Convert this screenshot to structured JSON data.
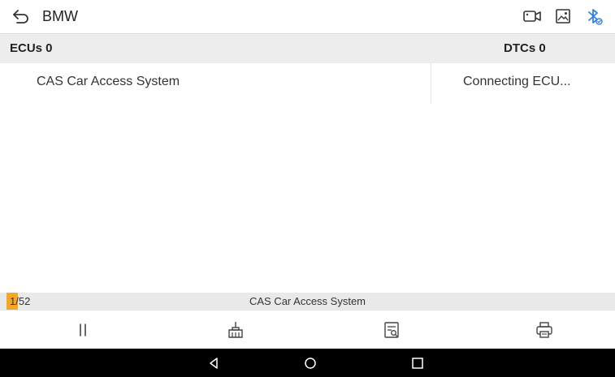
{
  "header": {
    "title": "BMW",
    "icons": [
      "back-icon",
      "video-icon",
      "image-icon",
      "bluetooth-icon"
    ]
  },
  "columns": {
    "left_label": "ECUs 0",
    "right_label": "DTCs 0"
  },
  "rows": [
    {
      "system": "CAS Car Access System",
      "status": "Connecting ECU..."
    }
  ],
  "progress": {
    "count": "1/52",
    "fraction": 0.019,
    "current": "CAS Car Access System"
  },
  "actions": [
    "pause-icon",
    "clear-icon",
    "report-icon",
    "print-icon"
  ],
  "colors": {
    "accent": "#f5a623",
    "bluetooth": "#2f80ed",
    "header_bg": "#ededed",
    "nav_bg": "#000000"
  }
}
